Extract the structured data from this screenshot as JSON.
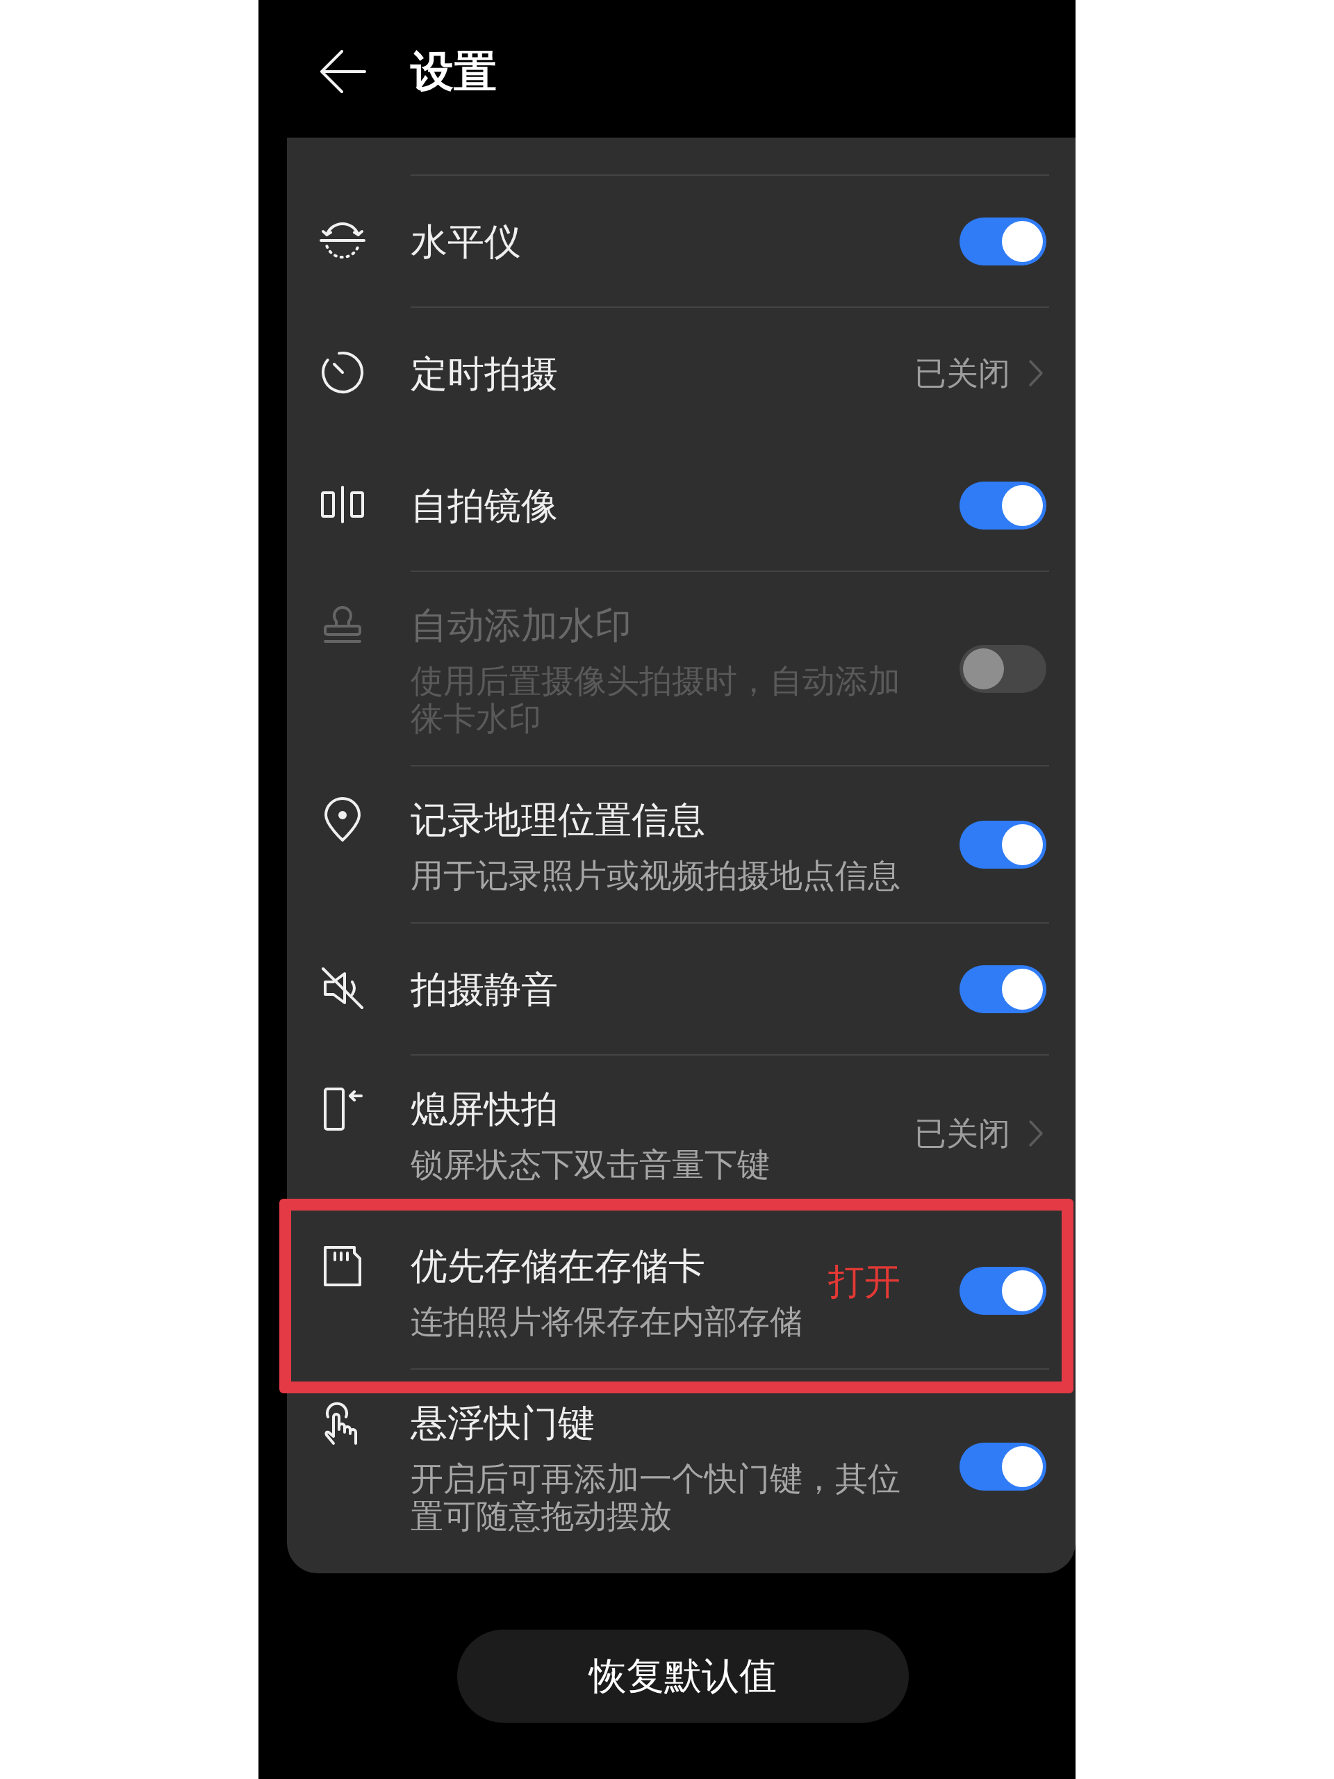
{
  "header": {
    "title": "设置"
  },
  "settings": [
    {
      "kind": "toggle",
      "title": "水平仪",
      "on": true,
      "disabled": false,
      "divider_above": true,
      "highlighted": false
    },
    {
      "kind": "link",
      "title": "定时拍摄",
      "value": "已关闭",
      "disabled": false,
      "divider_above": true,
      "highlighted": false
    },
    {
      "kind": "toggle",
      "title": "自拍镜像",
      "on": true,
      "disabled": false,
      "divider_above": false,
      "highlighted": false
    },
    {
      "kind": "toggle",
      "title": "自动添加水印",
      "subtitle": "使用后置摄像头拍摄时，自动添加徕卡水印",
      "on": false,
      "disabled": true,
      "divider_above": true,
      "highlighted": false
    },
    {
      "kind": "toggle",
      "title": "记录地理位置信息",
      "subtitle": "用于记录照片或视频拍摄地点信息",
      "on": true,
      "disabled": false,
      "divider_above": true,
      "highlighted": false
    },
    {
      "kind": "toggle",
      "title": "拍摄静音",
      "on": true,
      "disabled": false,
      "divider_above": true,
      "highlighted": false
    },
    {
      "kind": "link",
      "title": "熄屏快拍",
      "subtitle": "锁屏状态下双击音量下键",
      "value": "已关闭",
      "disabled": false,
      "divider_above": true,
      "highlighted": false
    },
    {
      "kind": "toggle",
      "title": "优先存储在存储卡",
      "subtitle": "连拍照片将保存在内部存储",
      "on": true,
      "disabled": false,
      "divider_above": false,
      "highlighted": true,
      "annotation": "打开"
    },
    {
      "kind": "toggle",
      "title": "悬浮快门键",
      "subtitle": "开启后可再添加一个快门键，其位置可随意拖动摆放",
      "on": true,
      "disabled": false,
      "divider_above": true,
      "highlighted": false
    }
  ],
  "reset_button": {
    "label": "恢复默认值"
  }
}
